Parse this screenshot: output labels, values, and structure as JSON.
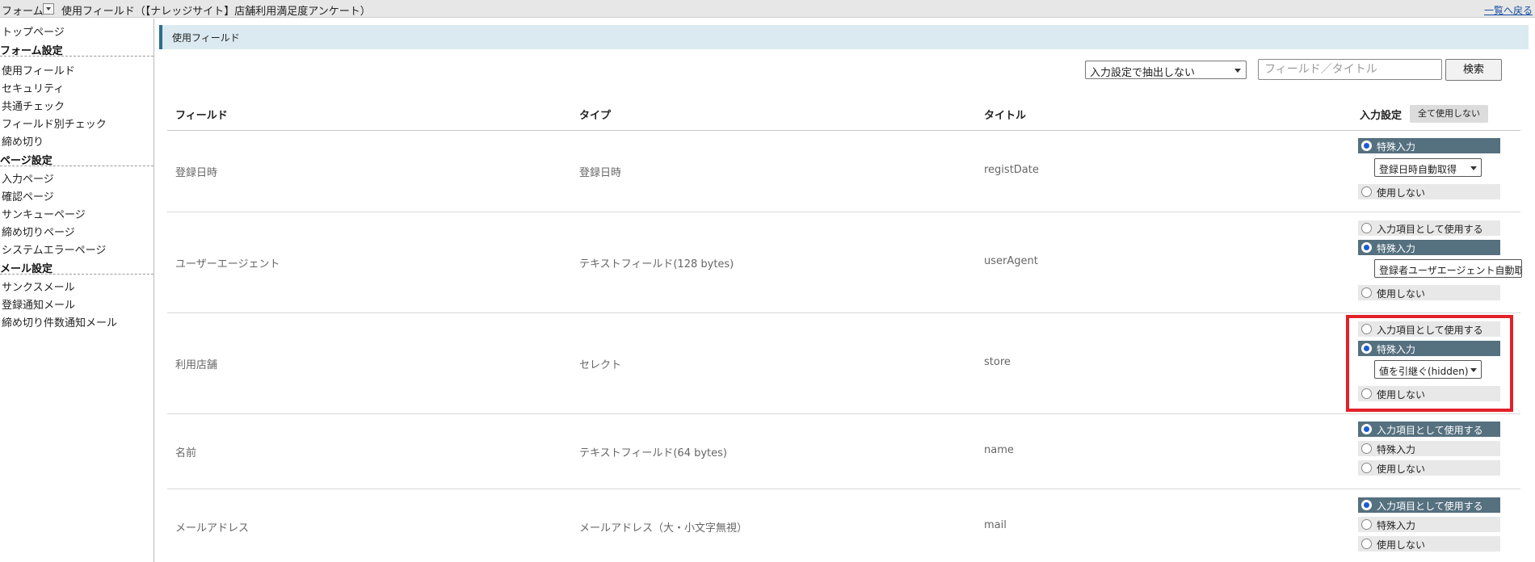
{
  "topbar": {
    "form_label": "フォーム",
    "breadcrumb": "使用フィールド（【ナレッジサイト】店舗利用満足度アンケート）",
    "back_link": "一覧へ戻る"
  },
  "sidebar": {
    "top_page": "トップページ",
    "form_settings": {
      "heading": "フォーム設定",
      "items": [
        "使用フィールド",
        "セキュリティ",
        "共通チェック",
        "フィールド別チェック",
        "締め切り"
      ]
    },
    "page_settings": {
      "heading": "ページ設定",
      "items": [
        "入力ページ",
        "確認ページ",
        "サンキューページ",
        "締め切りページ",
        "システムエラーページ"
      ]
    },
    "mail_settings": {
      "heading": "メール設定",
      "items": [
        "サンクスメール",
        "登録通知メール",
        "締め切り件数通知メール"
      ]
    }
  },
  "main": {
    "title": "使用フィールド",
    "filter_select": "入力設定で抽出しない",
    "search_placeholder": "フィールド／タイトル",
    "search_button": "検索",
    "columns": {
      "field": "フィールド",
      "type": "タイプ",
      "title": "タイトル",
      "input_setting": "入力設定"
    },
    "disable_all_button": "全て使用しない",
    "option_labels": {
      "use_as_input": "入力項目として使用する",
      "special_input": "特殊入力",
      "not_used": "使用しない"
    },
    "rows": [
      {
        "field": "登録日時",
        "type": "登録日時",
        "title": "registDate",
        "selected": "special_input",
        "special_value": "登録日時自動取得"
      },
      {
        "field": "ユーザーエージェント",
        "type": "テキストフィールド(128 bytes)",
        "title": "userAgent",
        "selected": "special_input",
        "special_value": "登録者ユーザエージェント自動取得"
      },
      {
        "field": "利用店舗",
        "type": "セレクト",
        "title": "store",
        "selected": "special_input",
        "special_value": "値を引継ぐ(hidden)"
      },
      {
        "field": "名前",
        "type": "テキストフィールド(64 bytes)",
        "title": "name",
        "selected": "use_as_input"
      },
      {
        "field": "メールアドレス",
        "type": "メールアドレス（大・小文字無視）",
        "title": "mail",
        "selected": "use_as_input"
      }
    ]
  },
  "colors": {
    "selected_option_bg": "#55707f",
    "highlight_border": "#e3202a",
    "title_bar_bg": "#dbeaf1",
    "title_bar_accent": "#2d6d8c"
  }
}
